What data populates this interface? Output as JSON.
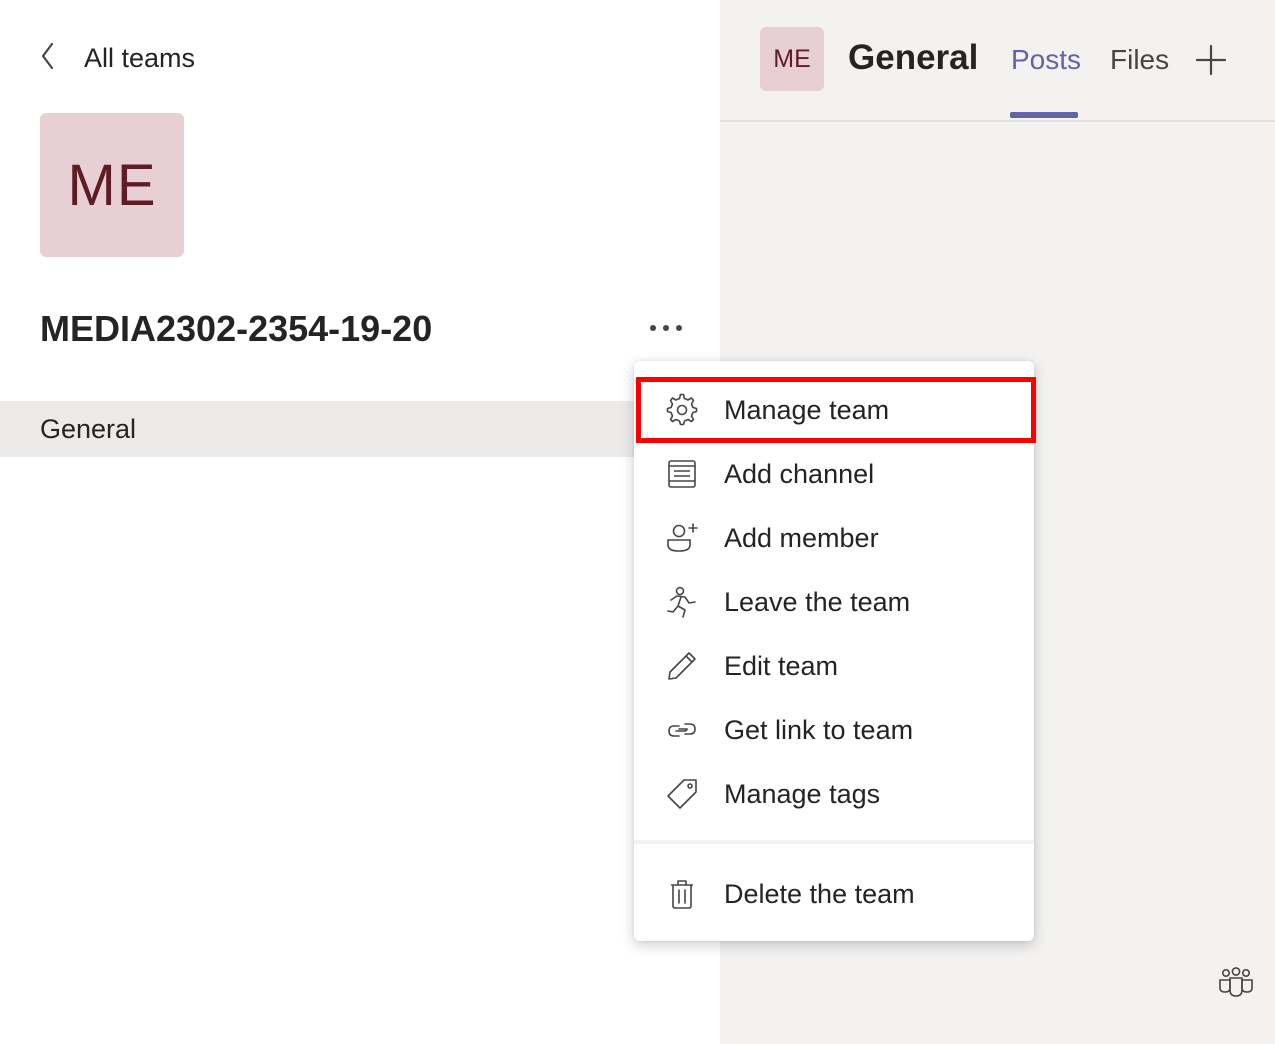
{
  "nav": {
    "back_label": "All teams"
  },
  "team": {
    "initials": "ME",
    "name": "MEDIA2302-2354-19-20"
  },
  "channels": [
    {
      "label": "General"
    }
  ],
  "header": {
    "initials": "ME",
    "title": "General",
    "tabs": [
      {
        "label": "Posts",
        "active": true
      },
      {
        "label": "Files",
        "active": false
      }
    ]
  },
  "menu": {
    "items": [
      {
        "label": "Manage team",
        "icon": "gear-icon",
        "highlighted": true
      },
      {
        "label": "Add channel",
        "icon": "channel-list-icon"
      },
      {
        "label": "Add member",
        "icon": "add-person-icon"
      },
      {
        "label": "Leave the team",
        "icon": "running-person-icon"
      },
      {
        "label": "Edit team",
        "icon": "pencil-icon"
      },
      {
        "label": "Get link to team",
        "icon": "link-icon"
      },
      {
        "label": "Manage tags",
        "icon": "tag-icon"
      },
      {
        "label": "Delete the team",
        "icon": "trash-icon"
      }
    ]
  },
  "colors": {
    "accent": "#6264a7",
    "avatar_bg": "#e8cfd3",
    "avatar_text": "#5e1c24",
    "highlight": "#ff0000",
    "right_pane_bg": "#f3f2f1",
    "selected_channel_bg": "#edebe9"
  }
}
